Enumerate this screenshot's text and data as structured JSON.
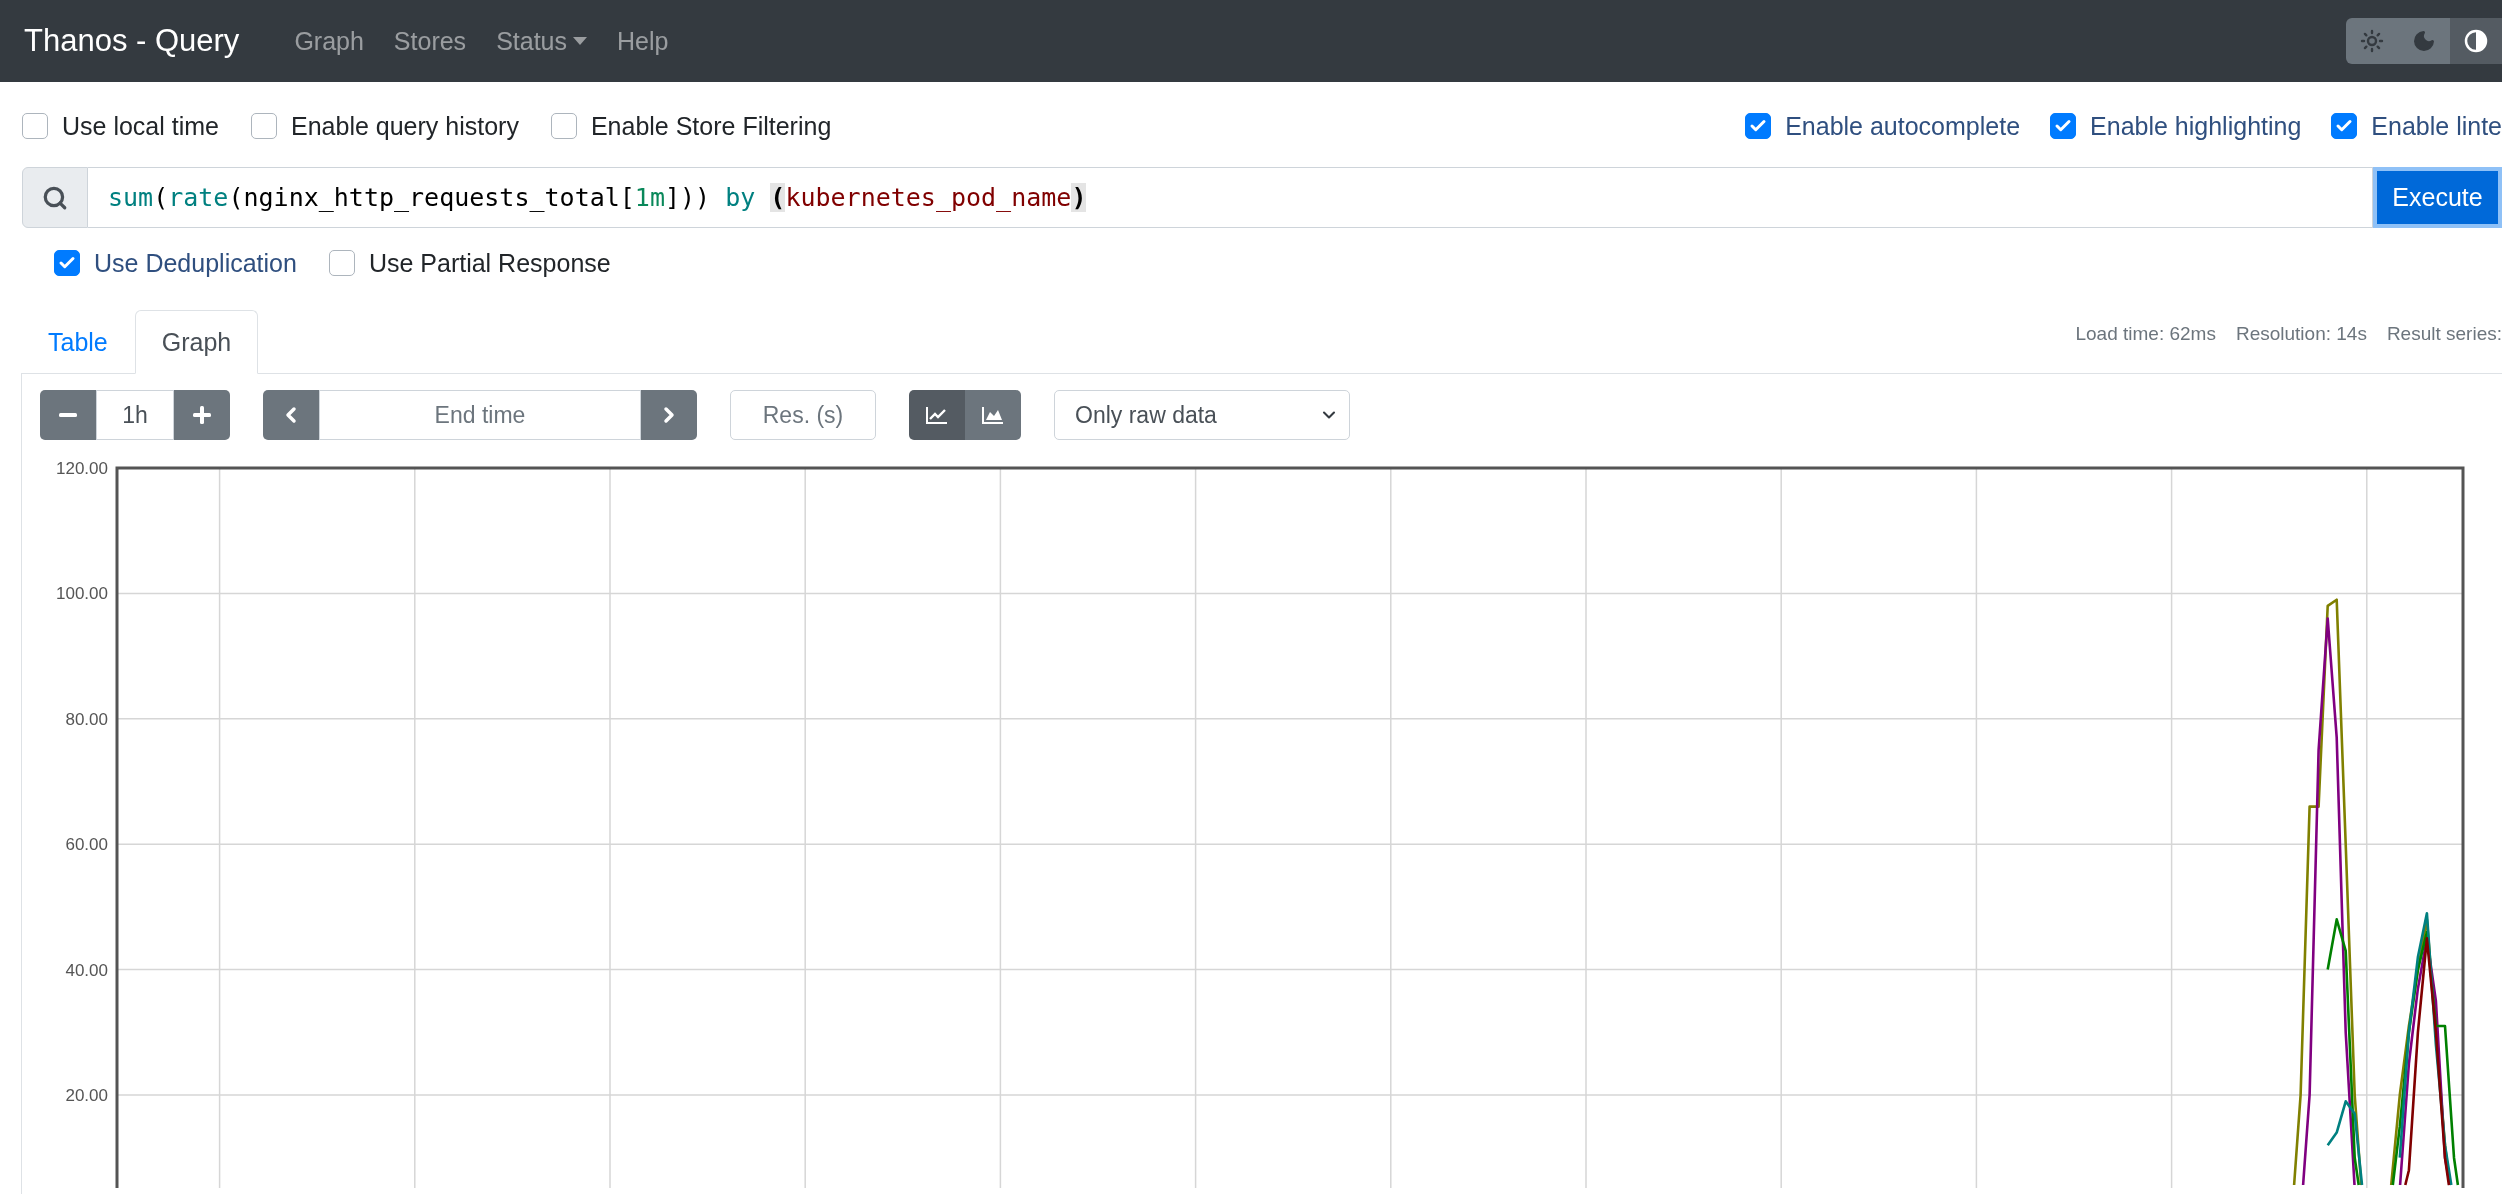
{
  "navbar": {
    "brand": "Thanos - Query",
    "links": [
      {
        "label": "Graph",
        "dropdown": false
      },
      {
        "label": "Stores",
        "dropdown": false
      },
      {
        "label": "Status",
        "dropdown": true
      },
      {
        "label": "Help",
        "dropdown": false
      }
    ],
    "theme_buttons": [
      {
        "kind": "light",
        "selected": false
      },
      {
        "kind": "dark",
        "selected": false
      },
      {
        "kind": "auto",
        "selected": true
      }
    ]
  },
  "options_left": [
    {
      "label": "Use local time",
      "checked": false
    },
    {
      "label": "Enable query history",
      "checked": false
    },
    {
      "label": "Enable Store Filtering",
      "checked": false
    }
  ],
  "options_right": [
    {
      "label": "Enable autocomplete",
      "checked": true
    },
    {
      "label": "Enable highlighting",
      "checked": true
    },
    {
      "label": "Enable linte",
      "checked": true
    }
  ],
  "query": {
    "tokens": [
      {
        "text": "sum",
        "kind": "function"
      },
      {
        "text": "(",
        "kind": "paren"
      },
      {
        "text": "rate",
        "kind": "function"
      },
      {
        "text": "(",
        "kind": "paren"
      },
      {
        "text": "nginx_http_requests_total",
        "kind": "metric"
      },
      {
        "text": "[",
        "kind": "paren"
      },
      {
        "text": "1m",
        "kind": "duration"
      },
      {
        "text": "]))",
        "kind": "paren"
      },
      {
        "text": " by ",
        "kind": "keyword"
      },
      {
        "text": "(",
        "kind": "matched_bracket"
      },
      {
        "text": "kubernetes_pod_name",
        "kind": "label"
      },
      {
        "text": ")",
        "kind": "matched_bracket"
      }
    ],
    "button": "Execute"
  },
  "query_options": [
    {
      "label": "Use Deduplication",
      "checked": true
    },
    {
      "label": "Use Partial Response",
      "checked": false
    }
  ],
  "tabs": [
    {
      "label": "Table",
      "selected": false
    },
    {
      "label": "Graph",
      "selected": true
    }
  ],
  "stats": [
    "Load time: 62ms",
    "Resolution: 14s",
    "Result series:"
  ],
  "graph_controls": {
    "range": "1h",
    "end_time_placeholder": "End time",
    "resolution_placeholder": "Res. (s)",
    "chart_modes": [
      {
        "kind": "lines",
        "selected": true
      },
      {
        "kind": "stacked",
        "selected": false
      }
    ],
    "data_mode": "Only raw data"
  },
  "graph": {
    "y_axis_labels": [
      "120.00",
      "100.00",
      "80.00",
      "60.00",
      "40.00",
      "20.00"
    ]
  }
}
